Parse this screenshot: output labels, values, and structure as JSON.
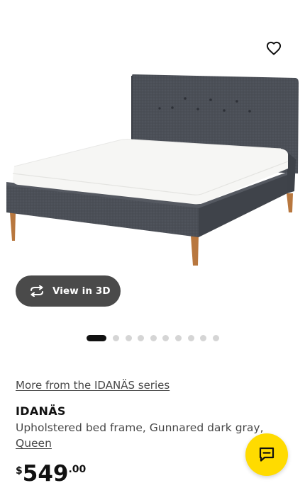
{
  "gallery": {
    "view_3d_label": "View in 3D",
    "slide_count": 10,
    "active_slide": 1
  },
  "icons": {
    "favorite": "heart-outline-icon",
    "view_3d": "rotate-3d-icon",
    "chat": "chat-bubble-icon"
  },
  "product": {
    "series_link": "More from the IDANÄS series",
    "name": "IDANÄS",
    "description": "Upholstered bed frame, Gunnared dark gray,",
    "size_link": "Queen",
    "price": {
      "currency": "$",
      "integer": "549",
      "decimal": ".00"
    }
  },
  "colors": {
    "accent_yellow": "#ffdb00",
    "text_primary": "#111111",
    "text_secondary": "#484848",
    "view_3d_bg": "#4a4a4a",
    "dot_inactive": "#d5d5d5"
  }
}
